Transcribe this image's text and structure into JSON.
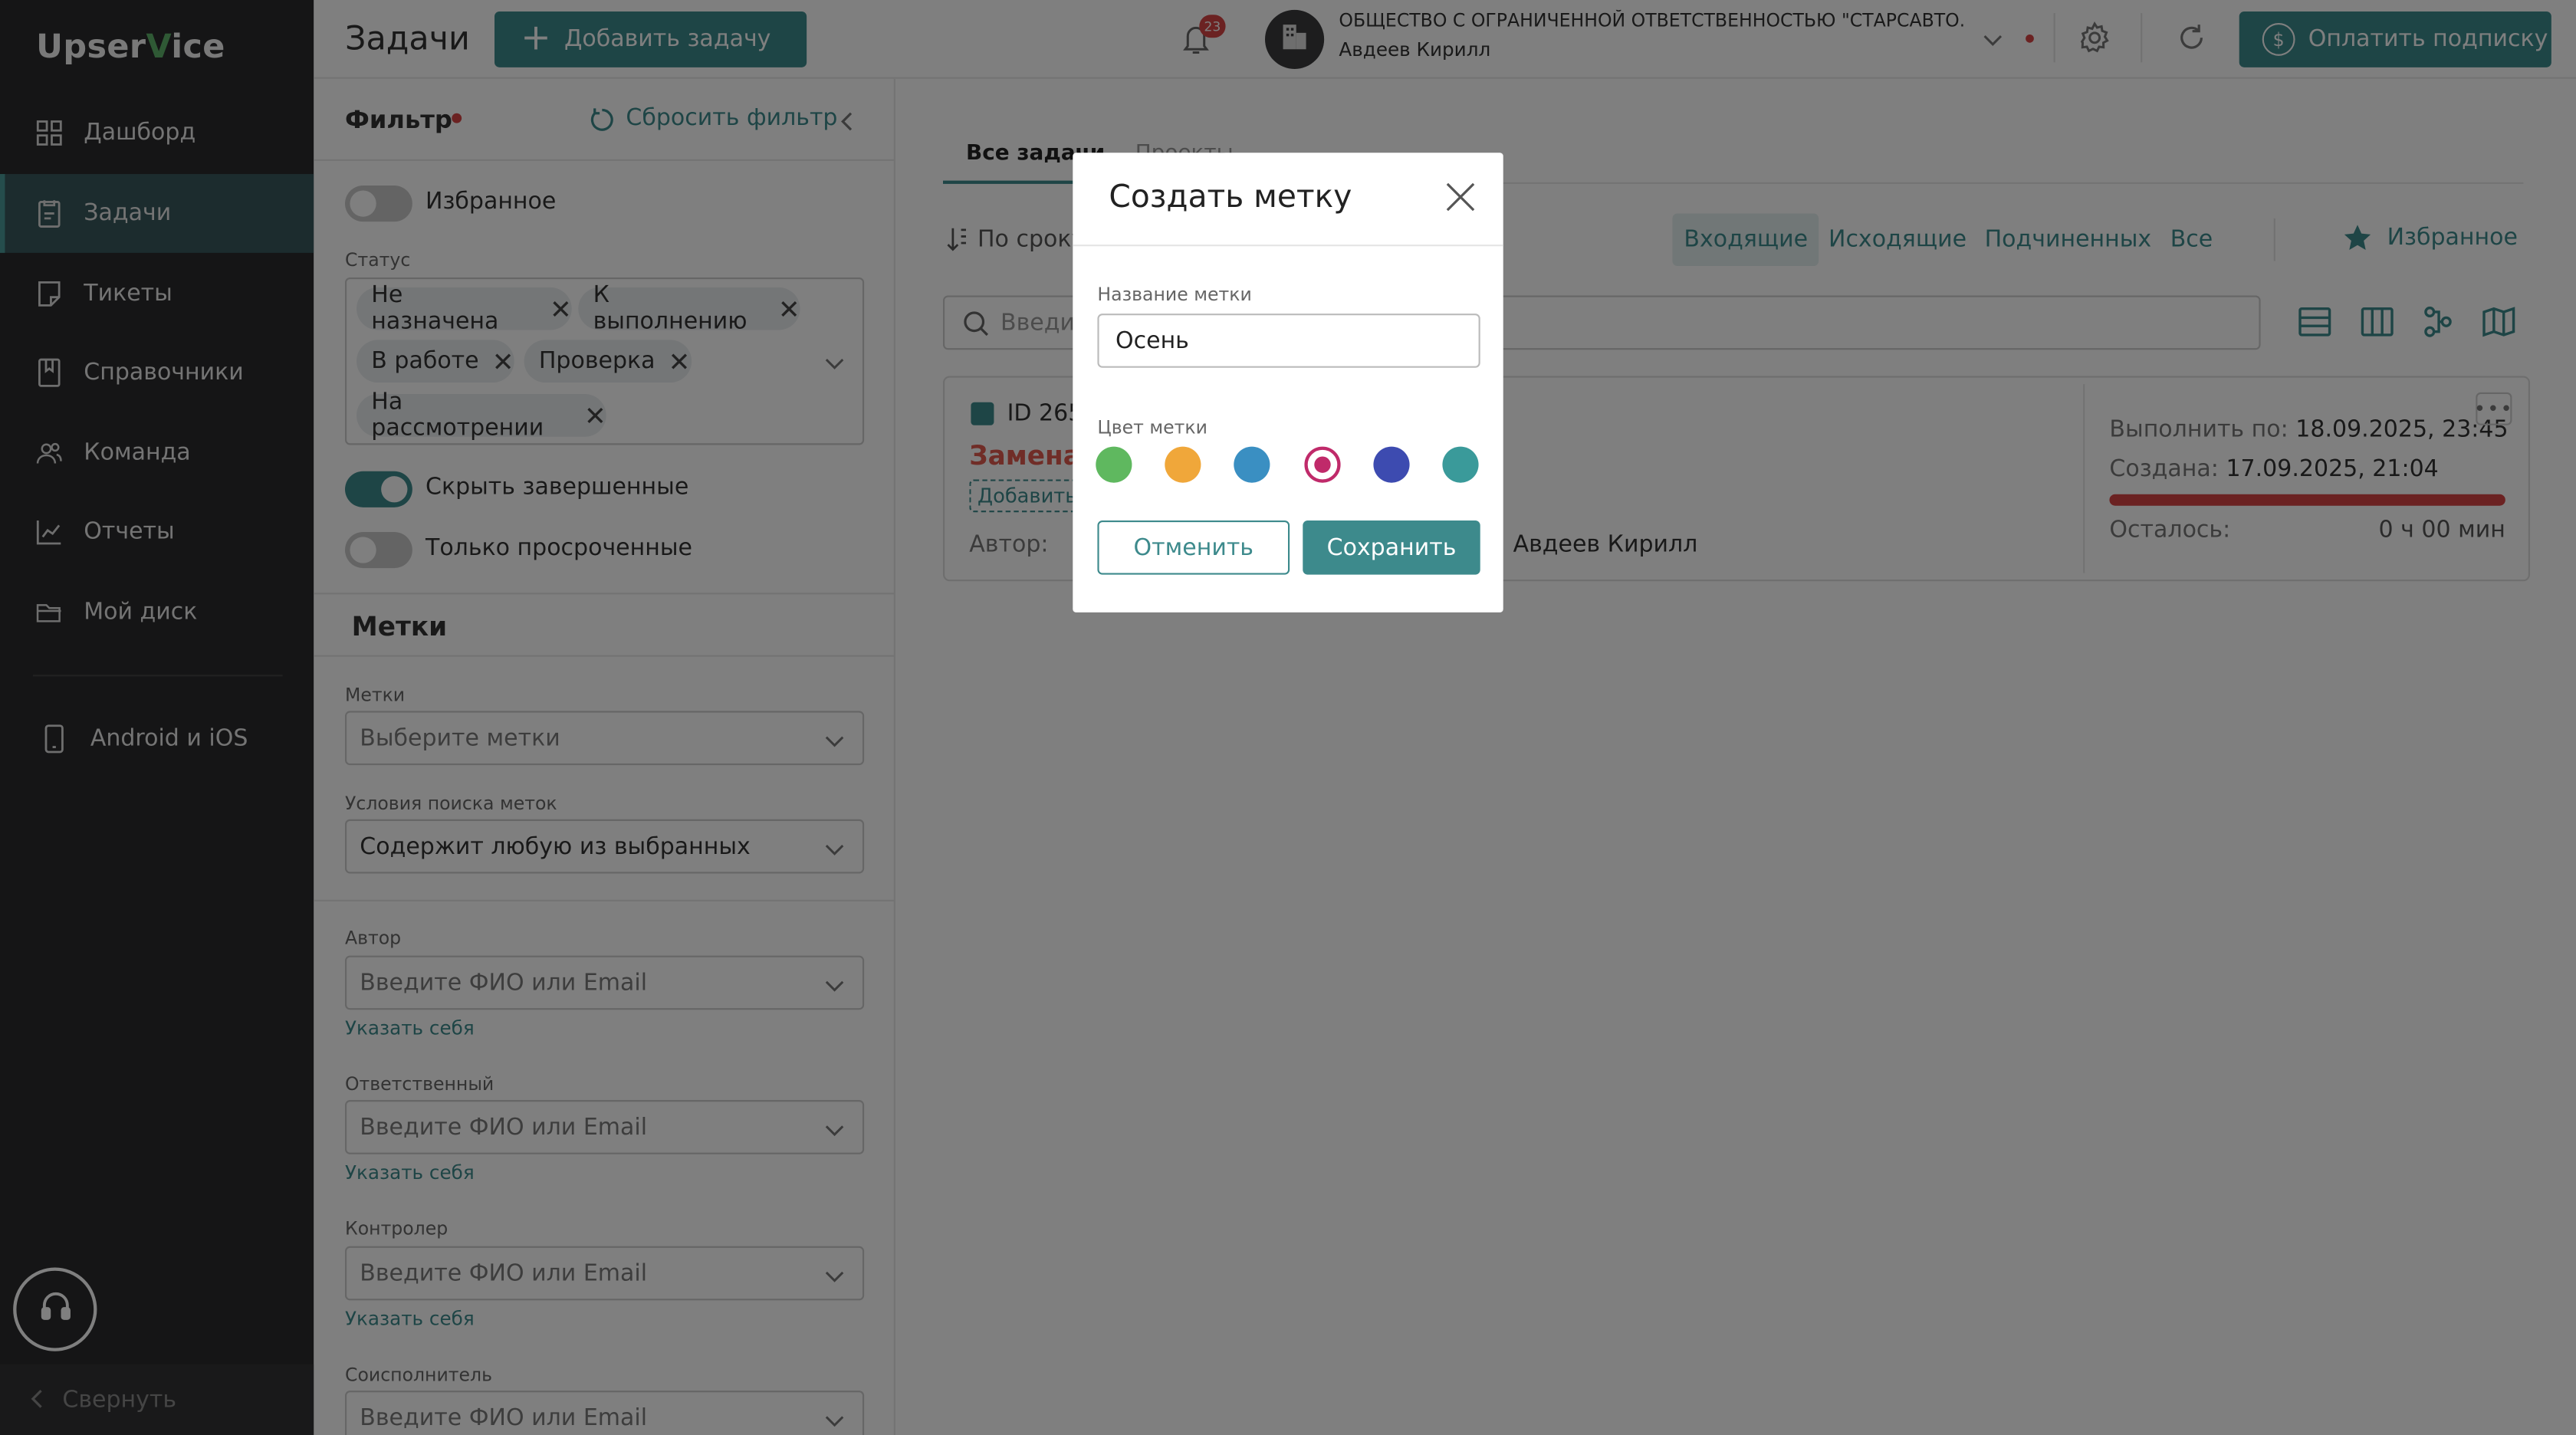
{
  "sidebar": {
    "logo_a": "Upser",
    "logo_v": "V",
    "logo_b": "ice",
    "items": [
      {
        "label": "Дашборд",
        "icon": "dashboard-icon"
      },
      {
        "label": "Задачи",
        "icon": "tasks-icon"
      },
      {
        "label": "Тикеты",
        "icon": "tickets-icon"
      },
      {
        "label": "Справочники",
        "icon": "book-icon"
      },
      {
        "label": "Команда",
        "icon": "team-icon"
      },
      {
        "label": "Отчеты",
        "icon": "chart-icon"
      },
      {
        "label": "Мой диск",
        "icon": "folder-icon"
      }
    ],
    "mobile_label": "Android и iOS",
    "collapse_label": "Свернуть"
  },
  "header": {
    "title": "Задачи",
    "add_task": "Добавить задачу",
    "notifications": "23",
    "org_name": "ОБЩЕСТВО С ОГРАНИЧЕННОЙ ОТВЕТСТВЕННОСТЬЮ \"СТАРСАВТО...",
    "user_name": "Авдеев Кирилл",
    "pay_label": "Оплатить подписку"
  },
  "filter": {
    "title": "Фильтр",
    "reset": "Сбросить фильтр",
    "favorite": "Избранное",
    "status_label": "Статус",
    "statuses": [
      "Не назначена",
      "К выполнению",
      "В работе",
      "Проверка",
      "На рассмотрении"
    ],
    "hide_completed": "Скрыть завершенные",
    "only_overdue": "Только просроченные",
    "tags_title": "Метки",
    "tags_label": "Метки",
    "tags_placeholder": "Выберите метки",
    "tag_search_label": "Условия поиска меток",
    "tag_search_value": "Содержит любую из выбранных",
    "author_label": "Автор",
    "responsible_label": "Ответственный",
    "controller_label": "Контролер",
    "coexec_label": "Соисполнитель",
    "person_placeholder": "Введите ФИО или Email",
    "self_link": "Указать себя"
  },
  "main": {
    "tab_all": "Все задачи",
    "tab_projects": "Проекты",
    "sort": "По сроку",
    "segments": [
      "Входящие",
      "Исходящие",
      "Подчиненных",
      "Все"
    ],
    "favorite": "Избранное",
    "search_placeholder": "Введите",
    "card": {
      "id": "ID 265",
      "title": "Замена",
      "add_label": "Добавить",
      "author_label": "Автор:",
      "assignee": "Авдеев Кирилл",
      "due_label": "Выполнить по:",
      "due_value": "18.09.2025, 23:45",
      "created_label": "Создана:",
      "created_value": "17.09.2025, 21:04",
      "left_label": "Осталось:",
      "left_value": "0 ч 00 мин"
    }
  },
  "modal": {
    "title": "Создать метку",
    "name_label": "Название метки",
    "name_value": "Осень",
    "color_label": "Цвет метки",
    "colors": [
      "#5fb85f",
      "#f0a73a",
      "#3a8fc2",
      "#c02a6a",
      "#3d4bb0",
      "#3a9a9a"
    ],
    "selected_color": "#c02a6a",
    "cancel": "Отменить",
    "save": "Сохранить"
  }
}
